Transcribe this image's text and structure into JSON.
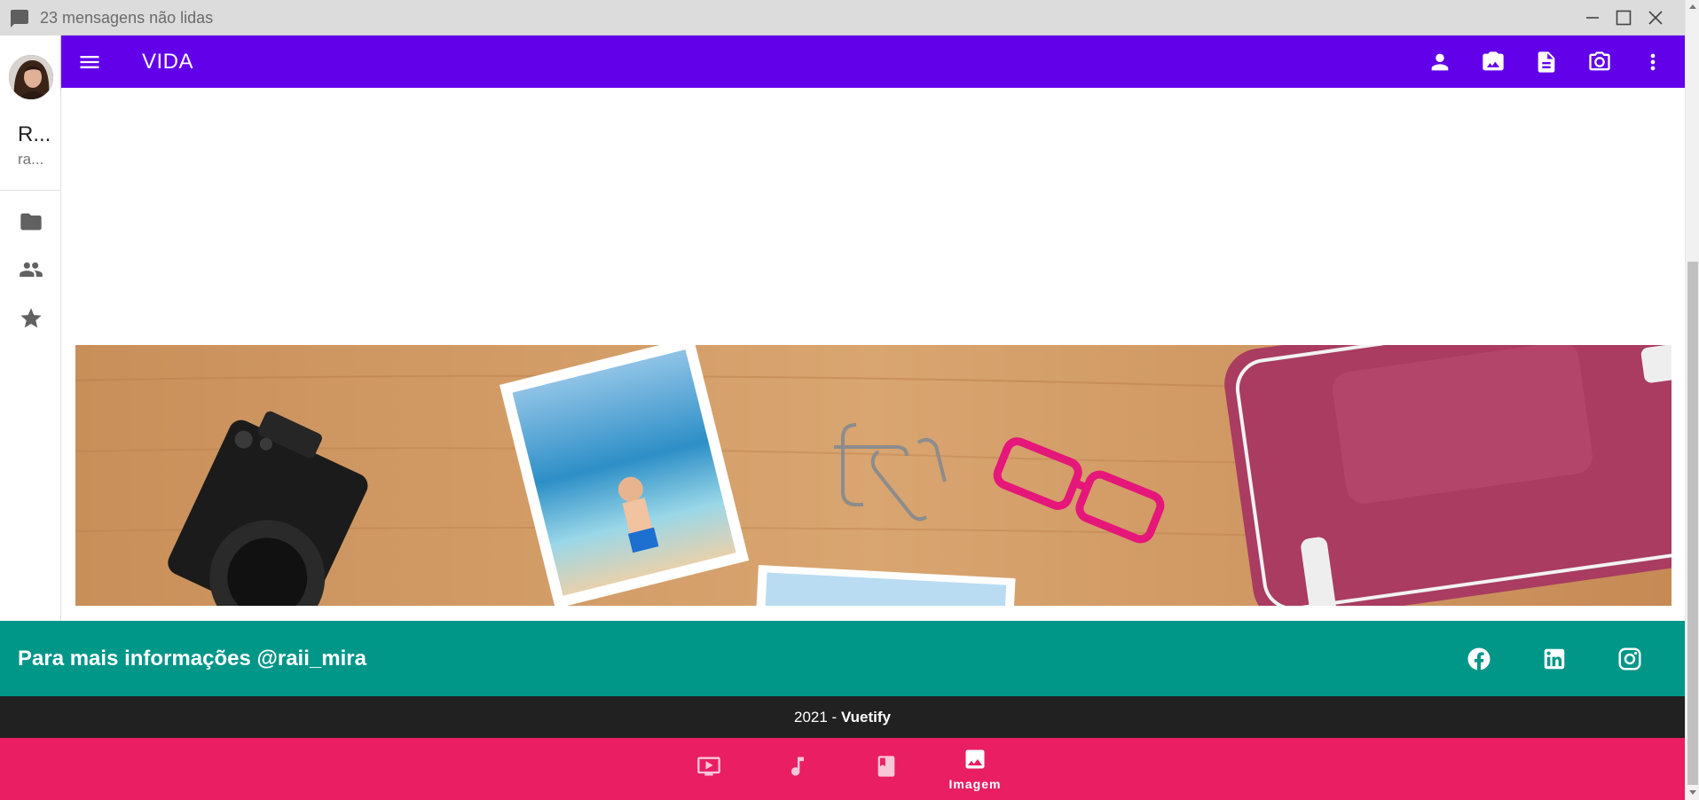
{
  "window": {
    "title": "23 mensagens não lidas",
    "title_icon": "chat-icon",
    "controls": [
      "minimize-icon",
      "maximize-icon",
      "close-icon"
    ]
  },
  "sidebar": {
    "avatar": "user-avatar",
    "user_name": "R...",
    "user_handle": "ra...",
    "items": [
      {
        "icon": "folder-icon"
      },
      {
        "icon": "people-icon"
      },
      {
        "icon": "star-icon"
      }
    ]
  },
  "appbar": {
    "title": "VIDA",
    "color": "#6200ea",
    "menu_icon": "menu-icon",
    "actions": [
      {
        "icon": "account-icon"
      },
      {
        "icon": "camera-image-icon"
      },
      {
        "icon": "file-document-icon"
      },
      {
        "icon": "camera-icon"
      },
      {
        "icon": "dots-vertical-icon"
      }
    ]
  },
  "main": {
    "banner_image": "travel-desk-photo"
  },
  "footer": {
    "info_text": "Para mais informações @raii_mira",
    "social": [
      "facebook-icon",
      "linkedin-icon",
      "instagram-icon"
    ],
    "copyright_year": "2021 - ",
    "copyright_brand": "Vuetify",
    "teal_color": "#009688",
    "dark_color": "#212121"
  },
  "bottom_nav": {
    "color": "#e91e63",
    "items": [
      {
        "icon": "television-play-icon",
        "label": ""
      },
      {
        "icon": "music-note-icon",
        "label": ""
      },
      {
        "icon": "book-icon",
        "label": ""
      },
      {
        "icon": "image-icon",
        "label": "Imagem",
        "active": true
      }
    ]
  }
}
